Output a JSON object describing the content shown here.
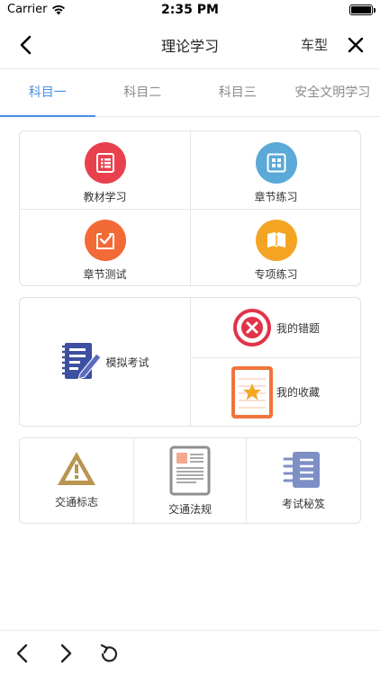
{
  "status_bar": {
    "carrier": "Carrier",
    "time": "2:35 PM"
  },
  "nav": {
    "title": "理论学习",
    "car_type": "车型"
  },
  "tabs": [
    {
      "label": "科目一",
      "active": true
    },
    {
      "label": "科目二",
      "active": false
    },
    {
      "label": "科目三",
      "active": false
    },
    {
      "label": "安全文明学习",
      "active": false
    }
  ],
  "study_grid": {
    "items": [
      {
        "label": "教材学习",
        "icon": "textbook-icon",
        "color": "#e8404d"
      },
      {
        "label": "章节练习",
        "icon": "chapter-practice-icon",
        "color": "#5aa9d8"
      },
      {
        "label": "章节测试",
        "icon": "chapter-test-icon",
        "color": "#f26a36"
      },
      {
        "label": "专项练习",
        "icon": "special-practice-icon",
        "color": "#f4a423"
      }
    ]
  },
  "exam_block": {
    "mock_exam": {
      "label": "模拟考试",
      "icon": "mock-exam-icon",
      "color": "#3d4fa0"
    },
    "wrong_questions": {
      "label": "我的错题",
      "icon": "wrong-answer-icon",
      "color": "#e0344a"
    },
    "favorites": {
      "label": "我的收藏",
      "icon": "favorites-icon",
      "color": "#f0743b"
    }
  },
  "resources": {
    "items": [
      {
        "label": "交通标志",
        "icon": "traffic-sign-icon",
        "color": "#b89550"
      },
      {
        "label": "交通法规",
        "icon": "traffic-law-icon",
        "color": "#8f8f8f"
      },
      {
        "label": "考试秘笈",
        "icon": "exam-tips-icon",
        "color": "#7e8fc6"
      }
    ]
  },
  "toolbar": {
    "back": "back-arrow-icon",
    "forward": "forward-arrow-icon",
    "reload": "reload-icon"
  },
  "colors": {
    "accent": "#4a90e2"
  }
}
